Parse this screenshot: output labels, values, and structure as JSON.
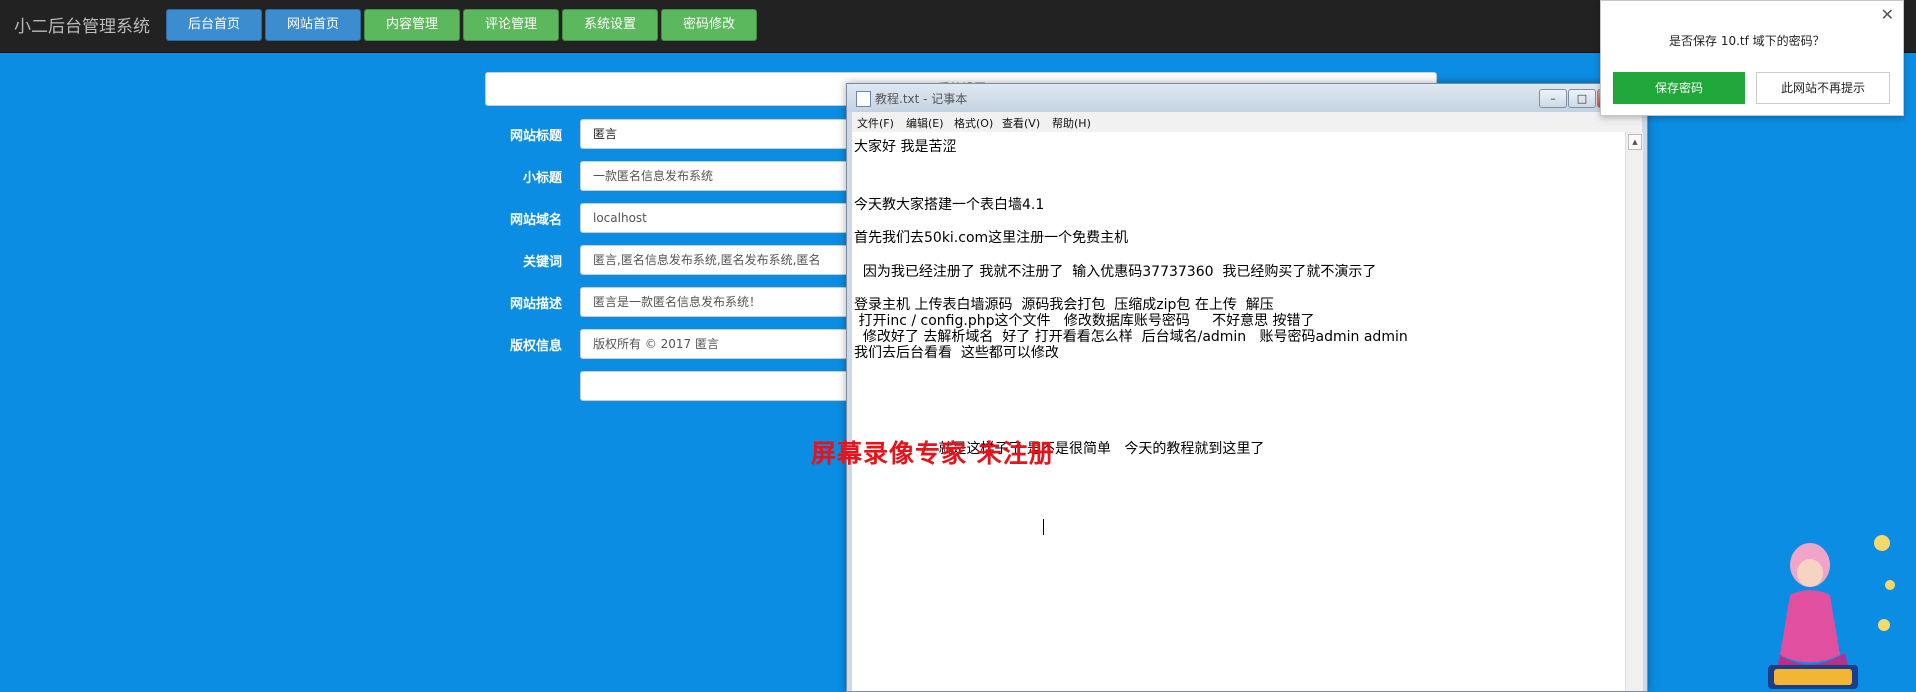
{
  "topbar": {
    "brand": "小二后台管理系统",
    "nav": [
      {
        "label": "后台首页",
        "color": "#3c8dd0"
      },
      {
        "label": "网站首页",
        "color": "#3c8dd0"
      },
      {
        "label": "内容管理",
        "color": "#5cb85c"
      },
      {
        "label": "评论管理",
        "color": "#5cb85c"
      },
      {
        "label": "系统设置",
        "color": "#5cb85c"
      },
      {
        "label": "密码修改",
        "color": "#5cb85c"
      }
    ]
  },
  "form": {
    "title": "系统设置",
    "fields": [
      {
        "label": "网站标题",
        "value": "匿言"
      },
      {
        "label": "小标题",
        "value": "一款匿名信息发布系统"
      },
      {
        "label": "网站域名",
        "value": "localhost"
      },
      {
        "label": "关键词",
        "value": "匿言,匿名信息发布系统,匿名发布系统,匿名"
      },
      {
        "label": "网站描述",
        "value": "匿言是一款匿名信息发布系统！"
      },
      {
        "label": "版权信息",
        "value": "版权所有 © 2017 匿言"
      }
    ],
    "extra_value": ""
  },
  "notepad": {
    "title": "教程.txt - 记事本",
    "menu": [
      "文件(F)",
      "编辑(E)",
      "格式(O)",
      "查看(V)",
      "帮助(H)"
    ],
    "lines": [
      "大家好 我是苦涩",
      "今天教大家搭建一个表白墙4.1",
      "首先我们去50ki.com这里注册一个免费主机",
      "  因为我已经注册了 我就不注册了  输入优惠码37737360  我已经购买了就不演示了",
      "登录主机 上传表白墙源码  源码我会打包  压缩成zip包 在上传  解压",
      " 打开inc / config.php这个文件   修改数据库账号密码     不好意思 按错了",
      "  修改好了 去解析域名  好了 打开看看怎么样  后台域名/admin   账号密码admin admin",
      "我们去后台看看  这些都可以修改",
      "                   就是这样子了 是不是很简单   今天的教程就到这里了"
    ]
  },
  "watermark": "屏幕录像专家 未注册",
  "password_prompt": {
    "message": "是否保存 10.tf 域下的密码？",
    "save_label": "保存密码",
    "never_label": "此网站不再提示",
    "close_glyph": "✕"
  },
  "colors": {
    "background": "#0a8de3",
    "nav_blue": "#3c8dd0",
    "nav_green": "#5cb85c",
    "save_green": "#1fa839",
    "watermark_red": "#e8131a"
  }
}
